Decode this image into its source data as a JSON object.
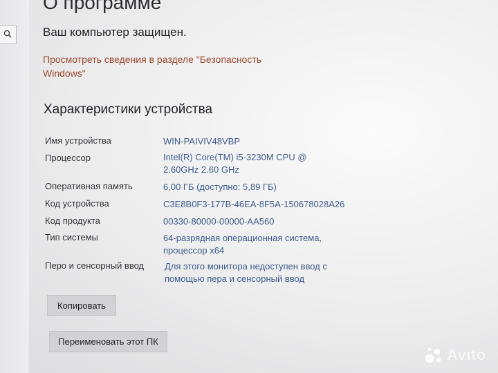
{
  "header": {
    "title": "О программе",
    "protected_text": "Ваш компьютер защищен.",
    "security_link": "Просмотреть сведения в разделе \"Безопасность Windows\""
  },
  "specs": {
    "heading": "Характеристики устройства",
    "rows": [
      {
        "label": "Имя устройства",
        "value": "WIN-PAIVIV48VBP"
      },
      {
        "label": "Процессор",
        "value": "Intel(R) Core(TM) i5-3230M CPU @ 2.60GHz   2.60 GHz"
      },
      {
        "label": "Оперативная память",
        "value": "6,00 ГБ (доступно: 5,89 ГБ)"
      },
      {
        "label": "Код устройства",
        "value": "C3E8B0F3-177B-46EA-8F5A-150678028A26"
      },
      {
        "label": "Код продукта",
        "value": "00330-80000-00000-AA560"
      },
      {
        "label": "Тип системы",
        "value": "64-разрядная операционная система, процессор x64"
      },
      {
        "label": "Перо и сенсорный ввод",
        "value": "Для этого монитора недоступен ввод с помощью пера и сенсорный ввод"
      }
    ]
  },
  "buttons": {
    "copy": "Копировать",
    "rename": "Переименовать этот ПК"
  },
  "watermark": {
    "text": "Avito",
    "icon": "avito-logo-icon"
  },
  "sidebar": {
    "search_icon": "search-icon"
  }
}
